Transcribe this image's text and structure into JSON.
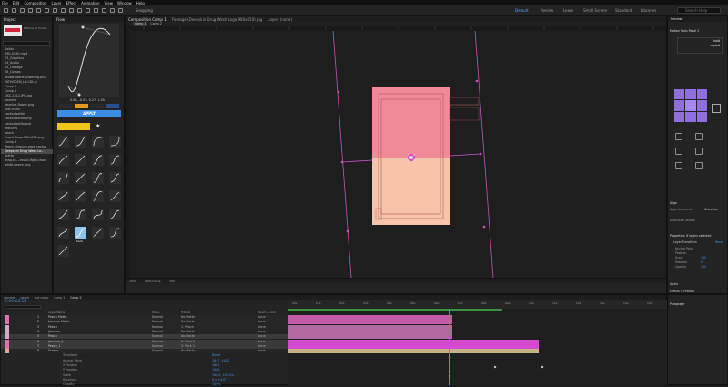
{
  "menubar": [
    "File",
    "Edit",
    "Composition",
    "Layer",
    "Effect",
    "Animation",
    "View",
    "Window",
    "Help"
  ],
  "toolbar": {
    "snapping": "Snapping"
  },
  "workspaces": [
    "Default",
    "Review",
    "Learn",
    "Small Screen",
    "Standard",
    "Libraries"
  ],
  "search_placeholder": "Search Help",
  "project": {
    "tab": "Project",
    "effects_tab": "Effect Controls",
    "selected_name": "Millions of Colors",
    "items": [
      "Solids",
      "IMG-5140.mp4",
      "03_Graphics",
      "04_Audio",
      "05_Footage",
      "06_Comps",
      "Yellow Bottle Lowering.png",
      "PATHOGEN_LX-CDL.ic",
      "Comp 2",
      "Comp 1",
      "DSC-1312.JPG.jpg",
      "jasmine",
      "jasmine-flower.png",
      "text-icons",
      "cactus bottle",
      "cactus bottle.png",
      "cactus bottle.psd",
      "Textures",
      "peach",
      "Peach-Drop-980x650.png",
      "Comp 3",
      "Peach-through-ease cactus",
      "Deepskin Drug Wash Lo...",
      "matte",
      "drag-to...-music-fight-chart",
      "white-peach.png"
    ]
  },
  "flow": {
    "tab": "Flow",
    "values": "0.68, -0.55, 0.27, 1.55",
    "apply_label": "APPLY",
    "selected_preset": "back"
  },
  "composition": {
    "tab_comp": "Composition Comp 1",
    "tab_footage": "Footage (Deepskin Drug Wash Logo 980x650).jpg",
    "tab_layer": "Layer: (none)",
    "subtabs": [
      "Comp 1",
      "Comp 2"
    ],
    "zoom": "25%",
    "timecode": "0:00:03:02",
    "quality": "Full"
  },
  "timeline": {
    "tabs": [
      "jasmine",
      "peach",
      "out comp",
      "comp 1",
      "Comp 2"
    ],
    "timecode": "0:00:03:02",
    "col_layer": "Layer Name",
    "col_mode": "Mode",
    "col_trkmat": "TrkMat",
    "col_parent": "Parent & Link",
    "ruler": [
      "00s",
      "01s",
      "02s",
      "03s",
      "04s",
      "05s",
      "06s",
      "07s",
      "08s",
      "09s",
      "10s",
      "11s",
      "12s",
      "13s",
      "14s",
      "15s"
    ],
    "layers": [
      {
        "num": "1",
        "name": "Peach Matte",
        "mode": "Normal",
        "trk": "No Matte",
        "par": "None",
        "color": "#e06fb6"
      },
      {
        "num": "2",
        "name": "Jasmine Matte",
        "mode": "Normal",
        "trk": "No Matte",
        "par": "None",
        "color": "#e06fb6"
      },
      {
        "num": "3",
        "name": "Peach",
        "mode": "Normal",
        "trk": "1. Peach",
        "par": "None",
        "color": "#d6a7c7"
      },
      {
        "num": "4",
        "name": "jasmine",
        "mode": "Normal",
        "trk": "No Matte",
        "par": "None",
        "color": "#d6a7c7"
      },
      {
        "num": "5",
        "name": "Peach",
        "mode": "Normal",
        "trk": "No Matte",
        "par": "None",
        "color": "#d6a7c7"
      },
      {
        "num": "6",
        "name": "jasmine_1",
        "mode": "Normal",
        "trk": "2. Pack 1",
        "par": "None",
        "color": "#e06fb6"
      },
      {
        "num": "7",
        "name": "Peach_1",
        "mode": "Normal",
        "trk": "3. Pack 1",
        "par": "None",
        "color": "#e06fb6"
      },
      {
        "num": "8",
        "name": "Screen",
        "mode": "Normal",
        "trk": "No Matte",
        "par": "None",
        "color": "#c8b28a"
      }
    ],
    "properties": [
      {
        "name": "Transform",
        "value": "Reset"
      },
      {
        "name": "Anchor Point",
        "value": "1647, 4423"
      },
      {
        "name": "X Position",
        "value": "1663"
      },
      {
        "name": "Y Position",
        "value": "1000"
      },
      {
        "name": "Scale",
        "value": "100.0, 100.0%"
      },
      {
        "name": "Rotation",
        "value": "0 x +0.0°"
      },
      {
        "name": "Opacity",
        "value": "100%"
      }
    ]
  },
  "right_panel": {
    "preview_tab": "Preview",
    "motion_tools": "Motion Tools Panel 2",
    "align_label": "Align",
    "align_to": "Align Layers to:",
    "selection": "Selection",
    "distribute": "Distribute Layers:",
    "properties_label": "Properties: 6 layers selected",
    "layer_transform": "Layer Transform",
    "reset": "Reset",
    "transform_props": [
      {
        "name": "Anchor Point",
        "value": ""
      },
      {
        "name": "Position",
        "value": ""
      },
      {
        "name": "Scale",
        "value": "100"
      },
      {
        "name": "Rotation",
        "value": "0"
      },
      {
        "name": "Opacity",
        "value": "100"
      }
    ],
    "audio": "Audio",
    "effects_presets": "Effects & Presets",
    "paragraph": "Paragraph",
    "hold_label": "hold",
    "copied_label": "copied"
  },
  "colors": {
    "accent": "#2d8ceb",
    "magenta": "#c94fc2",
    "pink_top": "#f08a98",
    "peach_bottom": "#f6c4a8",
    "apply_blue": "#3a8ee6",
    "preset_yellow": "#f0c419",
    "tile_purple": "#8f6fe0"
  }
}
